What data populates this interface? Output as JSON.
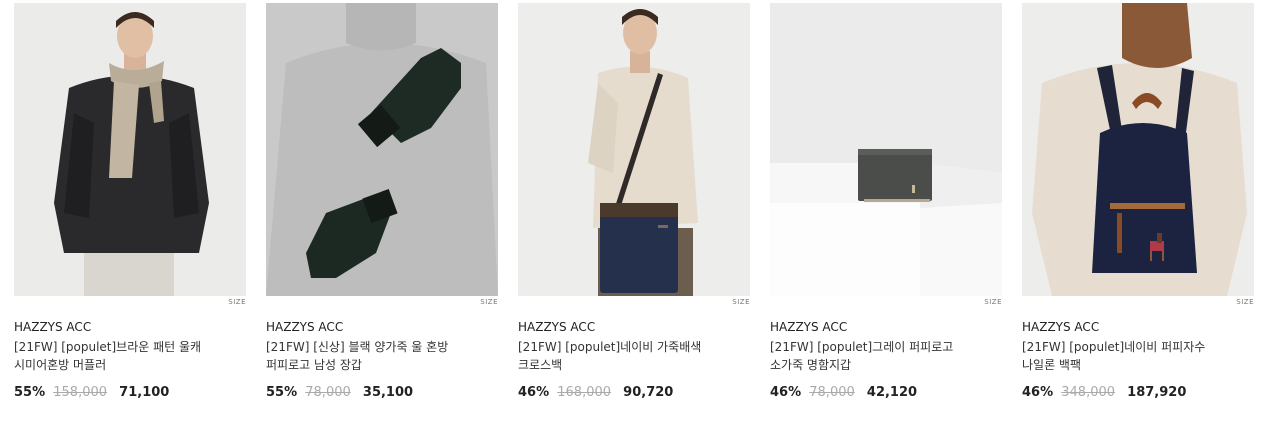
{
  "size_label": "SIZE",
  "products": [
    {
      "brand": "HAZZYS ACC",
      "name_line1": "[21FW] [populet]브라운 패턴 울캐",
      "name_line2": "시미어혼방 머플러",
      "discount": "55%",
      "original_price": "158,000",
      "final_price": "71,100",
      "image": "man-with-beige-scarf-and-black-jacket"
    },
    {
      "brand": "HAZZYS ACC",
      "name_line1": "[21FW] [신상] 블랙 양가죽 울 혼방",
      "name_line2": "퍼피로고 남성 장갑",
      "discount": "55%",
      "original_price": "78,000",
      "final_price": "35,100",
      "image": "dark-green-leather-gloves-on-grey-sweater"
    },
    {
      "brand": "HAZZYS ACC",
      "name_line1": "[21FW] [populet]네이비 가죽배색",
      "name_line2": "크로스백",
      "discount": "46%",
      "original_price": "168,000",
      "final_price": "90,720",
      "image": "man-with-navy-crossbody-bag"
    },
    {
      "brand": "HAZZYS ACC",
      "name_line1": "[21FW] [populet]그레이 퍼피로고",
      "name_line2": "소가죽 명함지갑",
      "discount": "46%",
      "original_price": "78,000",
      "final_price": "42,120",
      "image": "grey-leather-card-wallet-on-white-block"
    },
    {
      "brand": "HAZZYS ACC",
      "name_line1": "[21FW] [populet]네이비 퍼피자수",
      "name_line2": "나일론 백팩",
      "discount": "46%",
      "original_price": "348,000",
      "final_price": "187,920",
      "image": "woman-with-navy-nylon-backpack"
    }
  ]
}
